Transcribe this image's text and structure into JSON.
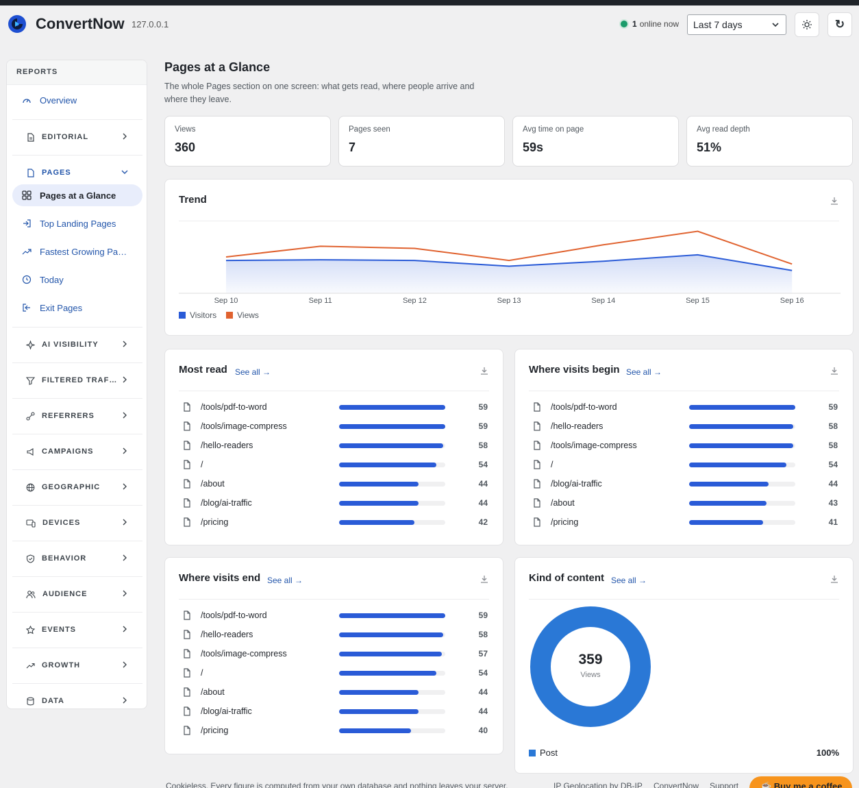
{
  "app": {
    "brand": "ConvertNow",
    "host": "127.0.0.1"
  },
  "header": {
    "online_count": "1",
    "online_label": "online now",
    "range": "Last 7 days",
    "theme_icon": "sun-icon",
    "refresh_icon": "refresh-icon"
  },
  "sidebar": {
    "heading": "REPORTS",
    "overview": "Overview",
    "groups": {
      "editorial": "EDITORIAL",
      "pages": "PAGES",
      "ai": "AI VISIBILITY",
      "filtered": "FILTERED TRAF…",
      "referrers": "REFERRERS",
      "campaigns": "CAMPAIGNS",
      "geographic": "GEOGRAPHIC",
      "devices": "DEVICES",
      "behavior": "BEHAVIOR",
      "audience": "AUDIENCE",
      "events": "EVENTS",
      "growth": "GROWTH",
      "data": "DATA"
    },
    "pages_items": {
      "glance": "Pages at a Glance",
      "landing": "Top Landing Pages",
      "fastest": "Fastest Growing Pa…",
      "today": "Today",
      "exit": "Exit Pages"
    }
  },
  "main": {
    "title": "Pages at a Glance",
    "description": "The whole Pages section on one screen: what gets read, where people arrive and where they leave.",
    "stats": [
      {
        "label": "Views",
        "value": "360"
      },
      {
        "label": "Pages seen",
        "value": "7"
      },
      {
        "label": "Avg time on page",
        "value": "59s"
      },
      {
        "label": "Avg read depth",
        "value": "51%"
      }
    ],
    "trend_title": "Trend",
    "see_all": "See all →",
    "most_read": {
      "title": "Most read",
      "rows": [
        {
          "path": "/tools/pdf-to-word",
          "value": "59"
        },
        {
          "path": "/tools/image-compress",
          "value": "59"
        },
        {
          "path": "/hello-readers",
          "value": "58"
        },
        {
          "path": "/",
          "value": "54"
        },
        {
          "path": "/about",
          "value": "44"
        },
        {
          "path": "/blog/ai-traffic",
          "value": "44"
        },
        {
          "path": "/pricing",
          "value": "42"
        }
      ]
    },
    "begin": {
      "title": "Where visits begin",
      "rows": [
        {
          "path": "/tools/pdf-to-word",
          "value": "59"
        },
        {
          "path": "/hello-readers",
          "value": "58"
        },
        {
          "path": "/tools/image-compress",
          "value": "58"
        },
        {
          "path": "/",
          "value": "54"
        },
        {
          "path": "/blog/ai-traffic",
          "value": "44"
        },
        {
          "path": "/about",
          "value": "43"
        },
        {
          "path": "/pricing",
          "value": "41"
        }
      ]
    },
    "end": {
      "title": "Where visits end",
      "rows": [
        {
          "path": "/tools/pdf-to-word",
          "value": "59"
        },
        {
          "path": "/hello-readers",
          "value": "58"
        },
        {
          "path": "/tools/image-compress",
          "value": "57"
        },
        {
          "path": "/",
          "value": "54"
        },
        {
          "path": "/about",
          "value": "44"
        },
        {
          "path": "/blog/ai-traffic",
          "value": "44"
        },
        {
          "path": "/pricing",
          "value": "40"
        }
      ]
    },
    "kind": {
      "title": "Kind of content",
      "total": "359",
      "total_label": "Views",
      "legend": "Post",
      "share": "100%"
    }
  },
  "footer": {
    "text": "Cookieless. Every figure is computed from your own database and nothing leaves your server.",
    "geo": "IP Geolocation by DB-IP",
    "brand": "ConvertNow",
    "support": "Support",
    "coffee": "☕ Buy me a coffee"
  },
  "colors": {
    "accent": "#2a5bd7",
    "views_line": "#e0622f",
    "donut": "#2a78d6"
  },
  "chart_data": [
    {
      "type": "line",
      "title": "Trend",
      "categories": [
        "Sep 10",
        "Sep 11",
        "Sep 12",
        "Sep 13",
        "Sep 14",
        "Sep 15",
        "Sep 16"
      ],
      "series": [
        {
          "name": "Visitors",
          "values": [
            46,
            47,
            46,
            38,
            45,
            54,
            32
          ]
        },
        {
          "name": "Views",
          "values": [
            51,
            66,
            63,
            46,
            68,
            87,
            41
          ]
        }
      ],
      "ylim": [
        0,
        100
      ],
      "legend": "bottom-left",
      "grid": false
    },
    {
      "type": "pie",
      "categories": [
        "Post"
      ],
      "values": [
        359
      ]
    }
  ]
}
